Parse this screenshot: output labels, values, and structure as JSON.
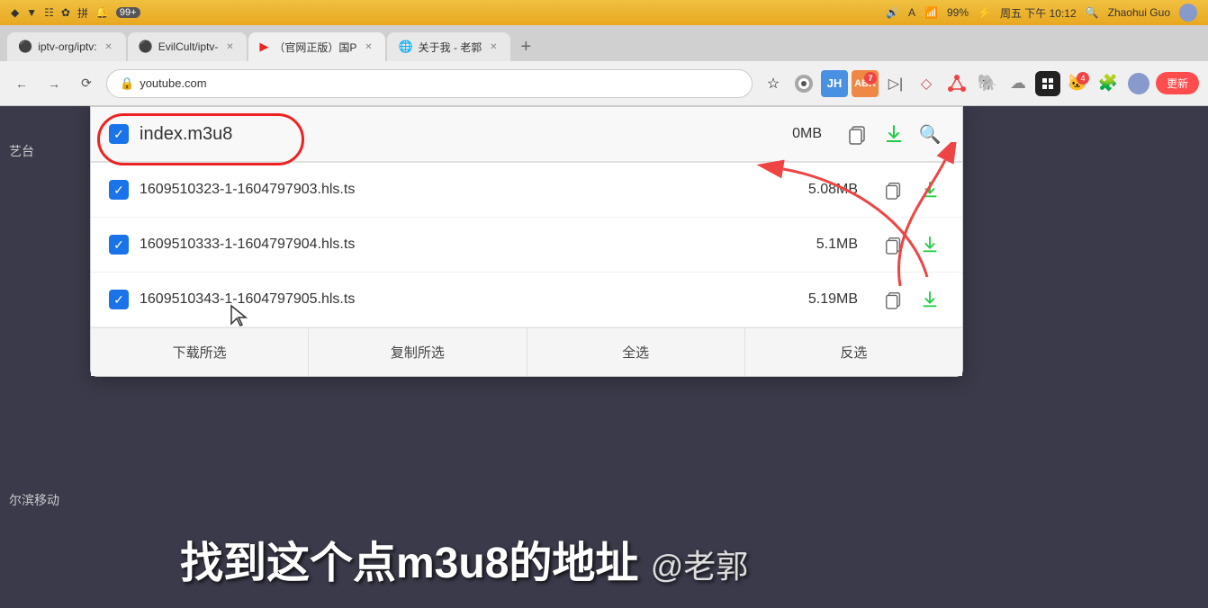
{
  "macos_bar": {
    "left_icons": [
      "▼",
      "▽",
      "☷",
      "✦",
      "✿",
      "♣"
    ],
    "notification": "99+",
    "volume_icon": "🔊",
    "input_indicator": "A",
    "wifi_icon": "wifi",
    "battery": "99%",
    "charge_icon": "⚡",
    "datetime": "周五 下午 10:12",
    "search_icon": "🔍",
    "user": "Zhaohui Guo"
  },
  "tabs": [
    {
      "id": "tab1",
      "icon": "github",
      "label": "iptv-org/iptv:",
      "active": false
    },
    {
      "id": "tab2",
      "icon": "github",
      "label": "EvilCult/iptv-",
      "active": false
    },
    {
      "id": "tab3",
      "icon": "youtube",
      "label": "（官网正版）国P",
      "active": true
    },
    {
      "id": "tab4",
      "icon": "globe",
      "label": "关于我 - 老郭",
      "active": false
    }
  ],
  "toolbar": {
    "bookmark_icon": "☆",
    "update_label": "更新",
    "address": "youtube.com"
  },
  "download_popup": {
    "rows": [
      {
        "id": "row0",
        "checked": true,
        "filename": "index.m3u8",
        "filesize": "0MB",
        "has_copy": true,
        "has_dl": true,
        "has_search": true
      },
      {
        "id": "row1",
        "checked": true,
        "filename": "1609510323-1-1604797903.hls.ts",
        "filesize": "5.08MB",
        "has_copy": true,
        "has_dl": true,
        "has_search": false
      },
      {
        "id": "row2",
        "checked": true,
        "filename": "1609510333-1-1604797904.hls.ts",
        "filesize": "5.1MB",
        "has_copy": true,
        "has_dl": true,
        "has_search": false
      },
      {
        "id": "row3",
        "checked": true,
        "filename": "1609510343-1-1604797905.hls.ts",
        "filesize": "5.19MB",
        "has_copy": true,
        "has_dl": true,
        "has_search": false
      }
    ],
    "buttons": [
      "下载所选",
      "复制所选",
      "全选",
      "反选"
    ]
  },
  "sidebar": {
    "label1": "艺台",
    "label2": "尔滨移动"
  },
  "subtitle": {
    "main": "找到这个点m3u8的地址",
    "at": "@老郭"
  }
}
